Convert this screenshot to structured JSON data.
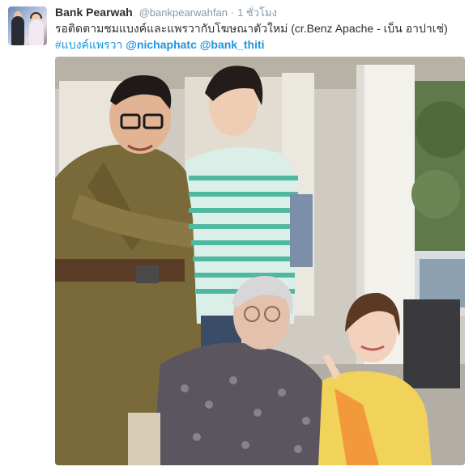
{
  "tweet": {
    "display_name": "Bank Pearwah",
    "handle": "@bankpearwahfan",
    "separator": "·",
    "time": "1 ชั่วโมง",
    "text_line1": "รอติดตามชมแบงค์และแพรวากับโฆษณาตัวใหม่ (cr.Benz Apache - เบ็น อาปาเช่)",
    "hashtag": "#แบงค์แพรวา",
    "mention1": "@nichaphatc",
    "mention2": "@bank_thiti"
  },
  "colors": {
    "link": "#1b95e0",
    "name": "#292f33",
    "meta": "#8899a6"
  },
  "icons": {
    "avatar": "profile-photo"
  }
}
